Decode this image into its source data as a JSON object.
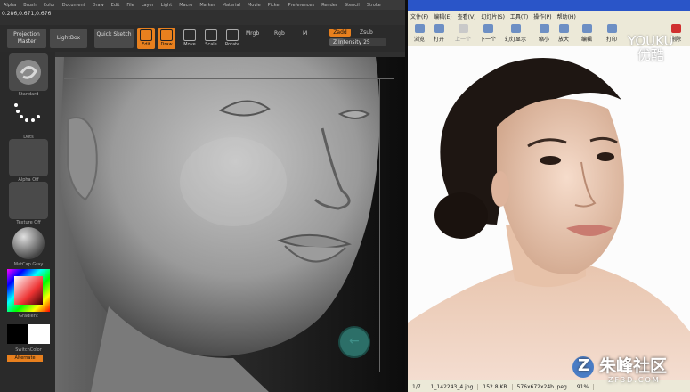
{
  "zbrush": {
    "menu": [
      "Alpha",
      "Brush",
      "Color",
      "Document",
      "Draw",
      "Edit",
      "File",
      "Layer",
      "Light",
      "Macro",
      "Marker",
      "Material",
      "Movie",
      "Picker",
      "Preferences",
      "Render",
      "Stencil",
      "Stroke"
    ],
    "coords": "0.286,0.671,0.676",
    "projection_master": "Projection Master",
    "lightbox": "LightBox",
    "quick_sketch": "Quick Sketch",
    "tools": [
      {
        "label": "Edit",
        "active": true,
        "icon": "edit-icon"
      },
      {
        "label": "Draw",
        "active": true,
        "icon": "draw-icon"
      },
      {
        "label": "Move",
        "active": false,
        "icon": "move-icon"
      },
      {
        "label": "Scale",
        "active": false,
        "icon": "scale-icon"
      },
      {
        "label": "Rotate",
        "active": false,
        "icon": "rotate-icon"
      }
    ],
    "mrgb_labels": [
      "Mrgb",
      "Rgb",
      "M"
    ],
    "zadd": "Zadd",
    "zsub": "Zsub",
    "z_intensity_label": "Z Intensity",
    "z_intensity": "25",
    "z_intensity_fraction": 0.25,
    "left_labels": [
      "Standard",
      "Dots",
      "Alpha Off",
      "Texture Off",
      "MatCap Gray",
      "Gradient",
      "SwitchColor",
      "Alternate"
    ],
    "accent": "#e8801e"
  },
  "viewer": {
    "menu": [
      "文件(F)",
      "编辑(E)",
      "查看(V)",
      "幻灯片(S)",
      "工具(T)",
      "操作(P)",
      "帮助(H)"
    ],
    "toolbar": [
      {
        "label": "浏览",
        "icon": "browse-icon",
        "enabled": true
      },
      {
        "label": "打开",
        "icon": "open-icon",
        "enabled": true
      },
      {
        "label": "上一个",
        "icon": "previous-icon",
        "enabled": false
      },
      {
        "label": "下一个",
        "icon": "next-icon",
        "enabled": true
      },
      {
        "label": "幻灯显示",
        "icon": "slideshow-icon",
        "enabled": true
      },
      {
        "label": "缩小",
        "icon": "zoom-out-icon",
        "enabled": true
      },
      {
        "label": "放大",
        "icon": "zoom-in-icon",
        "enabled": true
      },
      {
        "label": "编辑",
        "icon": "edit-icon",
        "enabled": true
      },
      {
        "label": "打印",
        "icon": "print-icon",
        "enabled": true
      },
      {
        "label": "删除",
        "icon": "delete-icon",
        "enabled": true
      }
    ],
    "status": [
      "1/7",
      "1_142243_4.jpg",
      "152.8 KB",
      "576x672x24b jpeg",
      "91%"
    ]
  },
  "watermarks": {
    "youku_en": "YOUKU",
    "youku_cn": "优酷",
    "site_cn": "朱峰社区",
    "site_url": "ZF3D.COM"
  }
}
